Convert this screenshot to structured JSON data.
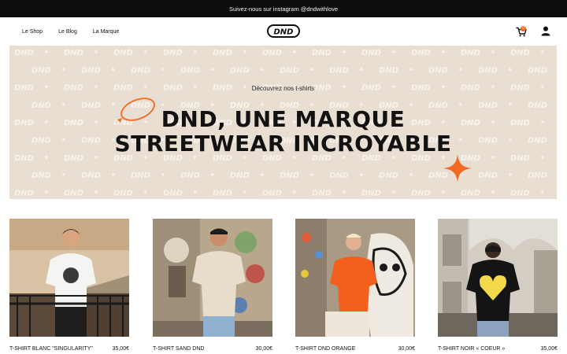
{
  "announcement": "Suivez-nous sur instagram @dndwithlove",
  "nav": {
    "links": [
      "Le Shop",
      "Le Blog",
      "La Marque"
    ],
    "logo_text": "DND",
    "cart_count": "0"
  },
  "hero": {
    "subtitle": "Découvrez nos t-shirts",
    "title_line1": "DND, UNE MARQUE",
    "title_line2": "STREETWEAR INCROYABLE",
    "pattern_word": "DND",
    "pattern_spark": "✦",
    "background_color": "#e9ded2",
    "accent_color": "#f26a22"
  },
  "products": [
    {
      "name": "T-SHIRT BLANC \"SINGULARITY\"",
      "price": "35,00€",
      "shirt_color": "#f4f4f2"
    },
    {
      "name": "T-SHIRT SAND DND",
      "price": "30,00€",
      "shirt_color": "#e8dccb"
    },
    {
      "name": "T-SHIRT DND ORANGE",
      "price": "30,00€",
      "shirt_color": "#f3601e"
    },
    {
      "name": "T-SHIRT NOIR « COEUR »",
      "price": "35,00€",
      "shirt_color": "#141414"
    }
  ]
}
